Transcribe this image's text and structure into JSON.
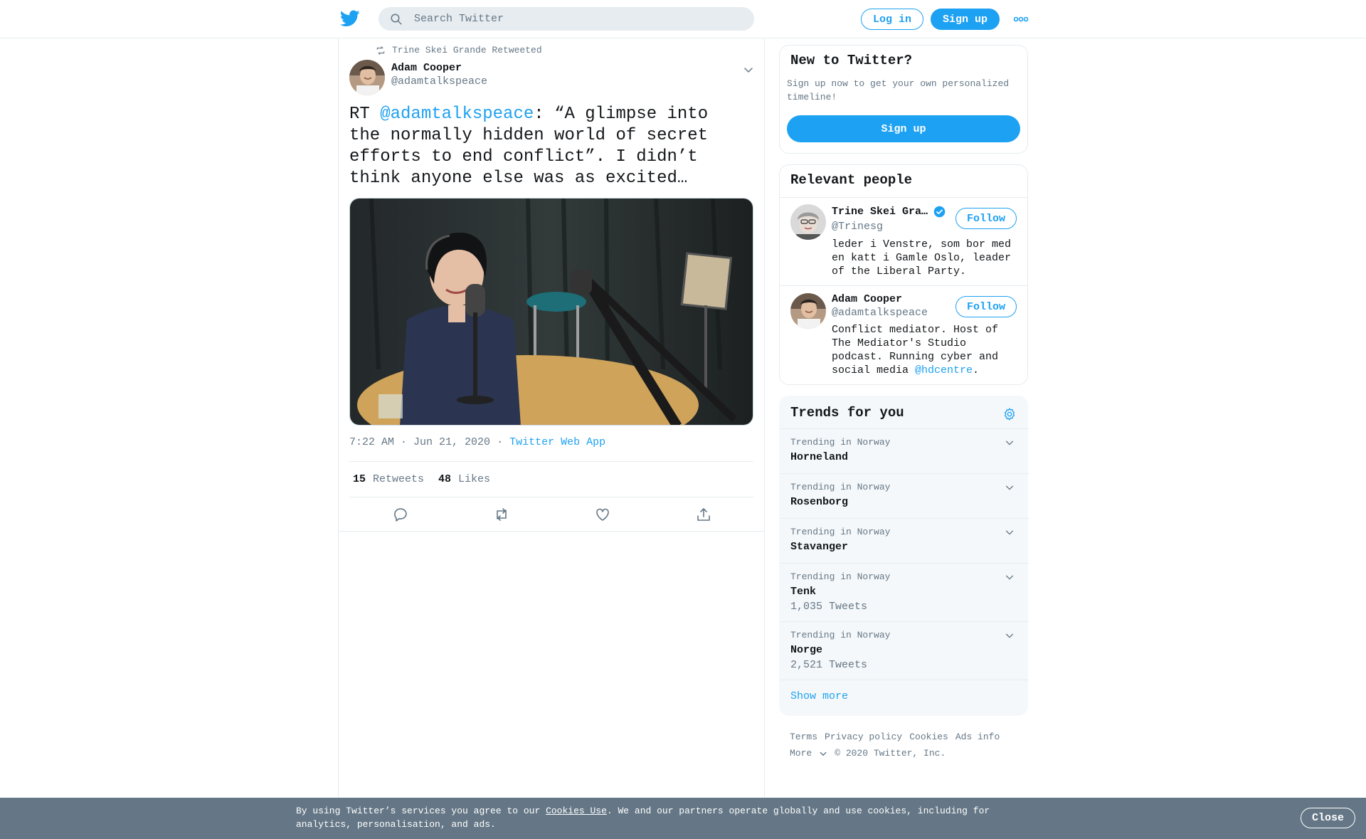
{
  "header": {
    "search_placeholder": "Search Twitter",
    "login_label": "Log in",
    "signup_label": "Sign up"
  },
  "tweet": {
    "retweeted_by": "Trine Skei Grande Retweeted",
    "author_name": "Adam Cooper",
    "author_handle": "@adamtalkspeace",
    "text_prefix": "RT ",
    "text_mention": "@adamtalkspeace",
    "text_body": ": “A glimpse into the normally hidden world of secret efforts to end conflict”. I didn’t think anyone else was as excited…",
    "timestamp": "7:22 AM · Jun 21, 2020",
    "separator": "·",
    "source_app": "Twitter Web App",
    "retweets_count": "15",
    "retweets_label": "Retweets",
    "likes_count": "48",
    "likes_label": "Likes"
  },
  "new_to_twitter": {
    "title": "New to Twitter?",
    "description": "Sign up now to get your own personalized timeline!",
    "signup_label": "Sign up"
  },
  "relevant_people": {
    "title": "Relevant people",
    "people": [
      {
        "name": "Trine Skei Gra…",
        "handle": "@Trinesg",
        "bio": "leder i Venstre, som bor med en katt i Gamle Oslo, leader of the Liberal Party.",
        "follow_label": "Follow",
        "verified": true
      },
      {
        "name": "Adam Cooper",
        "handle": "@adamtalkspeace",
        "bio_prefix": "Conflict mediator. Host of The Mediator's Studio podcast. Running cyber and social media ",
        "bio_mention": "@hdcentre",
        "bio_suffix": ".",
        "follow_label": "Follow",
        "verified": false
      }
    ]
  },
  "trends": {
    "title": "Trends for you",
    "items": [
      {
        "context": "Trending in Norway",
        "name": "Horneland",
        "count": ""
      },
      {
        "context": "Trending in Norway",
        "name": "Rosenborg",
        "count": ""
      },
      {
        "context": "Trending in Norway",
        "name": "Stavanger",
        "count": ""
      },
      {
        "context": "Trending in Norway",
        "name": "Tenk",
        "count": "1,035 Tweets"
      },
      {
        "context": "Trending in Norway",
        "name": "Norge",
        "count": "2,521 Tweets"
      }
    ],
    "show_more": "Show more"
  },
  "footer": {
    "links": [
      "Terms",
      "Privacy policy",
      "Cookies",
      "Ads info"
    ],
    "more": "More",
    "copyright": "© 2020 Twitter, Inc."
  },
  "cookie_bar": {
    "text_prefix": "By using Twitter’s services you agree to our ",
    "link": "Cookies Use",
    "text_suffix": ". We and our partners operate globally and use cookies, including for analytics, personalisation, and ads.",
    "close_label": "Close"
  },
  "colors": {
    "accent": "#1da1f2",
    "text": "#14171a",
    "muted": "#657786",
    "border": "#e6ecf0"
  }
}
